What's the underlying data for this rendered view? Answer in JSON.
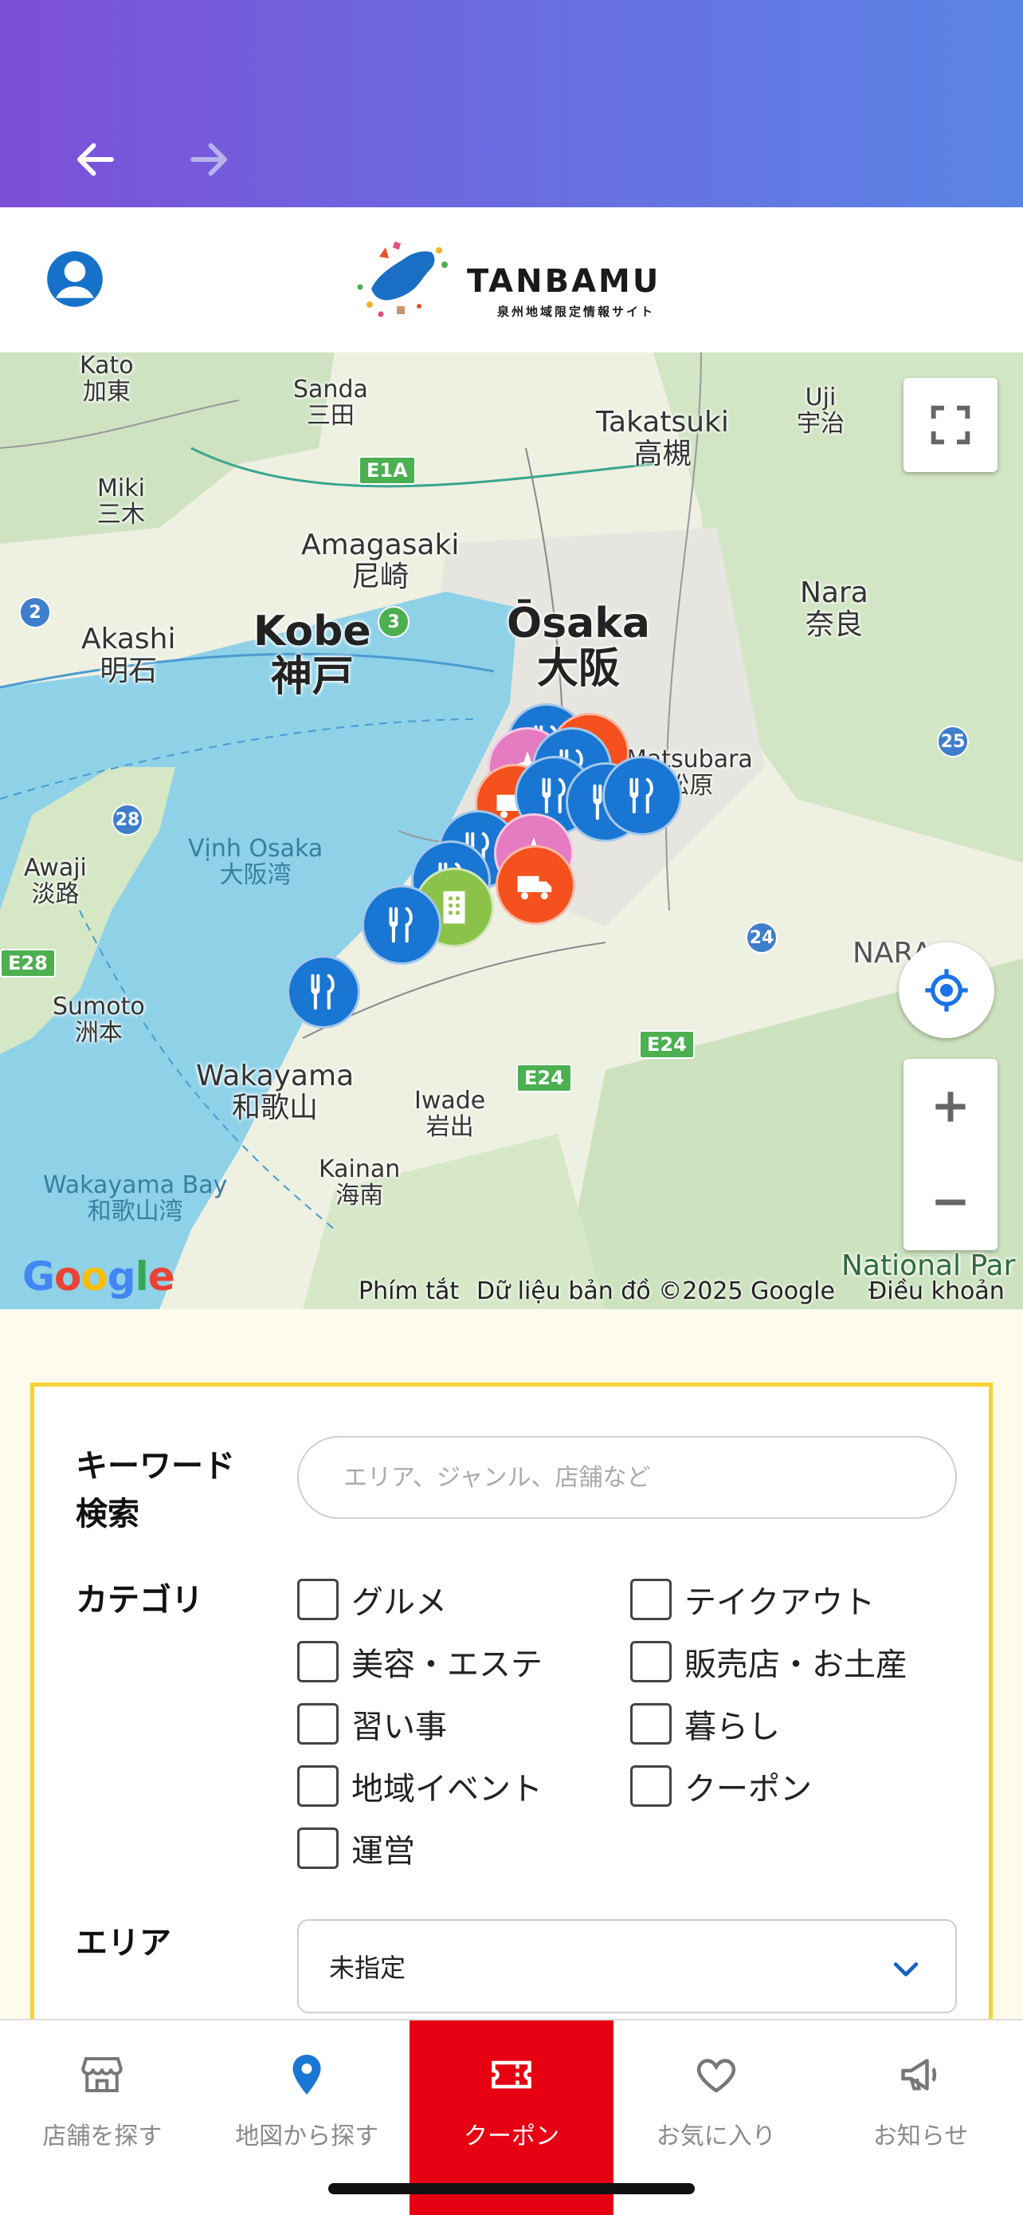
{
  "browser": {
    "back_icon": "arrow-left-icon",
    "forward_icon": "arrow-right-icon"
  },
  "header": {
    "account_icon": "user-circle-icon",
    "logo_title": "TANBAMU",
    "logo_subtitle": "泉州地域限定情報サイト"
  },
  "map": {
    "labels": [
      {
        "text": "Kato\n加東"
      },
      {
        "text": "Sanda\n三田"
      },
      {
        "text": "Uji\n宇治"
      },
      {
        "text": "Takatsuki\n高槻"
      },
      {
        "text": "Miki\n三木"
      },
      {
        "text": "Amagasaki\n尼崎"
      },
      {
        "text": "Kobe\n神戸"
      },
      {
        "text": "Ōsaka\n大阪"
      },
      {
        "text": "Nara\n奈良"
      },
      {
        "text": "Akashi\n明石"
      },
      {
        "text": "Matsubara\n松原"
      },
      {
        "text": "Awaji\n淡路"
      },
      {
        "text": "Sumoto\n洲本"
      },
      {
        "text": "Vịnh Osaka\n大阪湾"
      },
      {
        "text": "Wakayama\n和歌山"
      },
      {
        "text": "Iwade\n岩出"
      },
      {
        "text": "Kainan\n海南"
      },
      {
        "text": "Wakayama Bay\n和歌山湾"
      },
      {
        "text": "NARA"
      },
      {
        "text": "National Par"
      }
    ],
    "road_badges": [
      "E1A",
      "E24",
      "E24",
      "E28"
    ],
    "route_badges": [
      "2",
      "3",
      "28",
      "25",
      "24"
    ],
    "google_logo": "Google",
    "attribution": {
      "shortcuts": "Phím tắt",
      "data": "Dữ liệu bản đồ ©2025 Google",
      "terms": "Điều khoản"
    },
    "fullscreen_icon": "fullscreen-icon",
    "locate_icon": "crosshair-icon",
    "zoom_in_icon": "plus-icon",
    "zoom_out_icon": "minus-icon"
  },
  "search": {
    "keyword_label": "キーワード\n検索",
    "keyword_placeholder": "エリア、ジャンル、店舗など",
    "category_label": "カテゴリ",
    "categories": [
      {
        "label": "グルメ",
        "checked": false
      },
      {
        "label": "テイクアウト",
        "checked": false
      },
      {
        "label": "美容・エステ",
        "checked": false
      },
      {
        "label": "販売店・お土産",
        "checked": false
      },
      {
        "label": "習い事",
        "checked": false
      },
      {
        "label": "暮らし",
        "checked": false
      },
      {
        "label": "地域イベント",
        "checked": false
      },
      {
        "label": "クーポン",
        "checked": false
      },
      {
        "label": "運営",
        "checked": false
      }
    ],
    "area_label": "エリア",
    "area_value": "未指定"
  },
  "bottom_nav": [
    {
      "label": "店舗を探す",
      "icon": "store-icon",
      "active": false
    },
    {
      "label": "地図から探す",
      "icon": "map-pin-icon",
      "active": false
    },
    {
      "label": "クーポン",
      "icon": "coupon-icon",
      "active": true
    },
    {
      "label": "お気に入り",
      "icon": "heart-icon",
      "active": false
    },
    {
      "label": "お知らせ",
      "icon": "megaphone-icon",
      "active": false
    }
  ],
  "colors": {
    "gradient_start": "#7d4fd8",
    "gradient_end": "#5b84e6",
    "active_tab": "#e60012",
    "panel_border": "#f5d431",
    "marker_blue": "#1976d2",
    "marker_orange": "#f4511e",
    "marker_green": "#8bc34a",
    "marker_pink": "#e57bc0"
  }
}
